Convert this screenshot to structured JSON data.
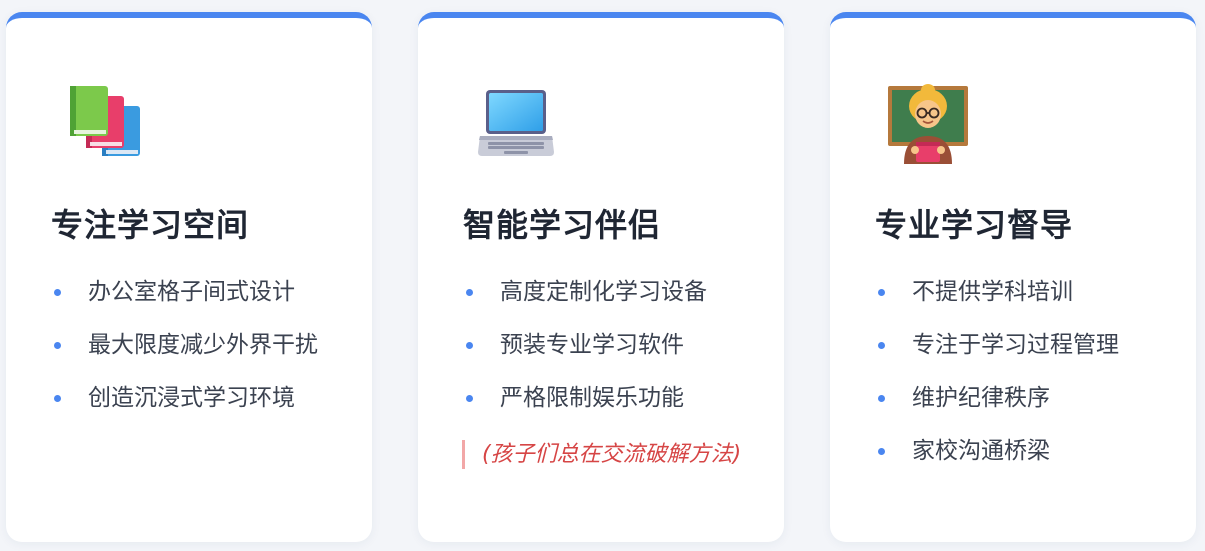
{
  "colors": {
    "accent": "#4a86f0",
    "title": "#1f2633",
    "text": "#3b4250",
    "note": "#d64545",
    "note_border": "#f2a7a7"
  },
  "cards": [
    {
      "icon": "books-icon",
      "title": "专注学习空间",
      "items": [
        "办公室格子间式设计",
        "最大限度减少外界干扰",
        "创造沉浸式学习环境"
      ]
    },
    {
      "icon": "laptop-icon",
      "title": "智能学习伴侣",
      "items": [
        "高度定制化学习设备",
        "预装专业学习软件",
        "严格限制娱乐功能"
      ],
      "note": "(孩子们总在交流破解方法)"
    },
    {
      "icon": "teacher-icon",
      "title": "专业学习督导",
      "items": [
        "不提供学科培训",
        "专注于学习过程管理",
        "维护纪律秩序",
        "家校沟通桥梁"
      ]
    }
  ]
}
